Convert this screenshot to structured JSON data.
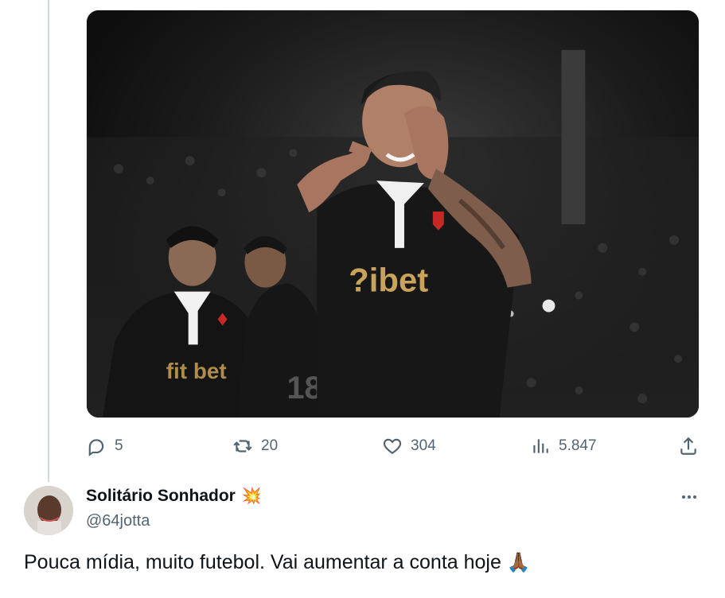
{
  "media": {
    "image_name": "football-player-celebration-photo"
  },
  "actions": {
    "reply_count": "5",
    "retweet_count": "20",
    "like_count": "304",
    "views_count": "5.847"
  },
  "reply_tweet": {
    "author_name": "Solitário Sonhador",
    "author_badge": "💥",
    "handle": "@64jotta",
    "text": "Pouca mídia, muito futebol. Vai aumentar a conta hoje",
    "emoji": "🙏🏾"
  },
  "icons": {
    "reply": "reply-icon",
    "retweet": "retweet-icon",
    "like": "heart-icon",
    "views": "views-icon",
    "share": "share-icon",
    "more": "more-icon"
  },
  "colors": {
    "secondary_text": "#536471",
    "primary_text": "#0f1419",
    "thread_line": "#cfd9de"
  }
}
